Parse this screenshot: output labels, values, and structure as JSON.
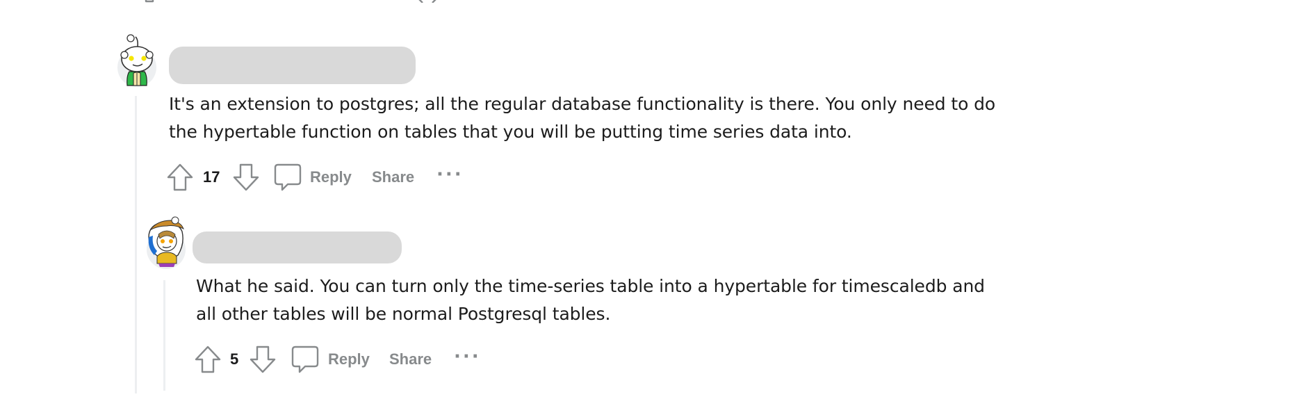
{
  "comments": [
    {
      "author_redacted": true,
      "avatar": "snoo-avatar-green-jacket",
      "body_lines": [
        "It's an extension to postgres; all the regular database functionality is there. You only need to do",
        "the hypertable function on tables that you will be putting time series data into."
      ],
      "score": "17",
      "actions": {
        "reply": "Reply",
        "share": "Share",
        "more": "···"
      }
    },
    {
      "author_redacted": true,
      "avatar": "snoo-avatar-parka",
      "body_lines": [
        "What he said. You can turn only the time-series table into a hypertable for timescaledb and",
        "all other tables will be normal Postgresql tables."
      ],
      "score": "5",
      "actions": {
        "reply": "Reply",
        "share": "Share",
        "more": "···"
      }
    }
  ],
  "icons": {
    "upvote": "arrow-up-outline",
    "downvote": "arrow-down-outline",
    "reply": "speech-bubble-outline",
    "more": "horizontal-ellipsis"
  },
  "colors": {
    "text": "#1c1c1c",
    "muted_action": "#878a8c",
    "thread_line": "#edeff1",
    "redaction": "#d9d9d9"
  }
}
